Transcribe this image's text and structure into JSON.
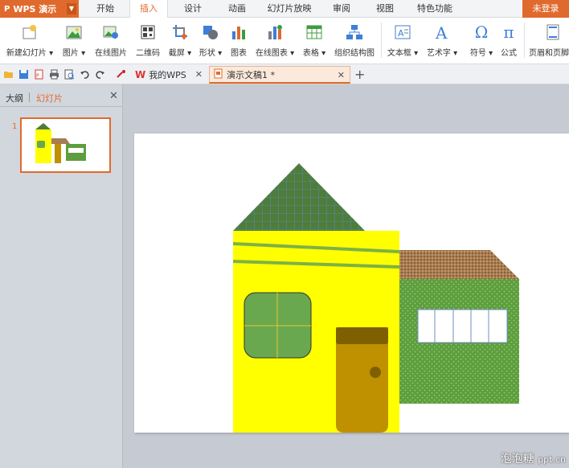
{
  "app": {
    "name": "WPS 演示",
    "login": "未登录"
  },
  "menu": {
    "tabs": [
      {
        "label": "开始"
      },
      {
        "label": "插入"
      },
      {
        "label": "设计"
      },
      {
        "label": "动画"
      },
      {
        "label": "幻灯片放映"
      },
      {
        "label": "审阅"
      },
      {
        "label": "视图"
      },
      {
        "label": "特色功能"
      }
    ],
    "active": "插入"
  },
  "ribbon": {
    "buttons": [
      {
        "label": "新建幻灯片 ▾",
        "icon": "new-slide-icon"
      },
      {
        "label": "图片 ▾",
        "icon": "picture-icon"
      },
      {
        "label": "在线图片",
        "icon": "online-picture-icon"
      },
      {
        "label": "二维码",
        "icon": "qrcode-icon"
      },
      {
        "label": "截屏 ▾",
        "icon": "screenshot-icon"
      },
      {
        "label": "形状 ▾",
        "icon": "shapes-icon"
      },
      {
        "label": "图表",
        "icon": "chart-icon"
      },
      {
        "label": "在线图表 ▾",
        "icon": "online-chart-icon"
      },
      {
        "label": "表格 ▾",
        "icon": "table-icon"
      },
      {
        "label": "组织结构图",
        "icon": "org-chart-icon"
      },
      {
        "label": "文本框 ▾",
        "icon": "textbox-icon"
      },
      {
        "label": "艺术字 ▾",
        "icon": "wordart-icon"
      },
      {
        "label": "符号 ▾",
        "icon": "symbol-icon",
        "glyph": "Ω"
      },
      {
        "label": "公式",
        "icon": "formula-icon",
        "glyph": "π"
      },
      {
        "label": "页眉和页脚",
        "icon": "header-footer-icon"
      }
    ]
  },
  "quickbar": {
    "icons": [
      "open-folder-icon",
      "save-icon",
      "export-pdf-icon",
      "print-icon",
      "print-preview-icon",
      "undo-icon",
      "redo-icon",
      "format-painter-icon"
    ]
  },
  "doctabs": [
    {
      "label": "我的WPS",
      "icon": "wps-logo-icon"
    },
    {
      "label": "演示文稿1 *",
      "icon": "presentation-doc-icon",
      "active": true
    }
  ],
  "leftpane": {
    "tabs": [
      {
        "label": "大纲"
      },
      {
        "label": "幻灯片"
      }
    ],
    "active": "幻灯片",
    "slides": [
      {
        "number": "1"
      }
    ]
  },
  "colors": {
    "accent": "#e06a2d",
    "roof": "#4e7d3b",
    "house_wall": "#ffff00",
    "window_green": "#6aa84f",
    "door": "#bf9000",
    "door_top": "#7f6000",
    "side_wall": "#5e9e3e",
    "side_roof": "#a67c52"
  },
  "watermark": {
    "text": "泡泡糖",
    "domain": "ppt.cn"
  }
}
